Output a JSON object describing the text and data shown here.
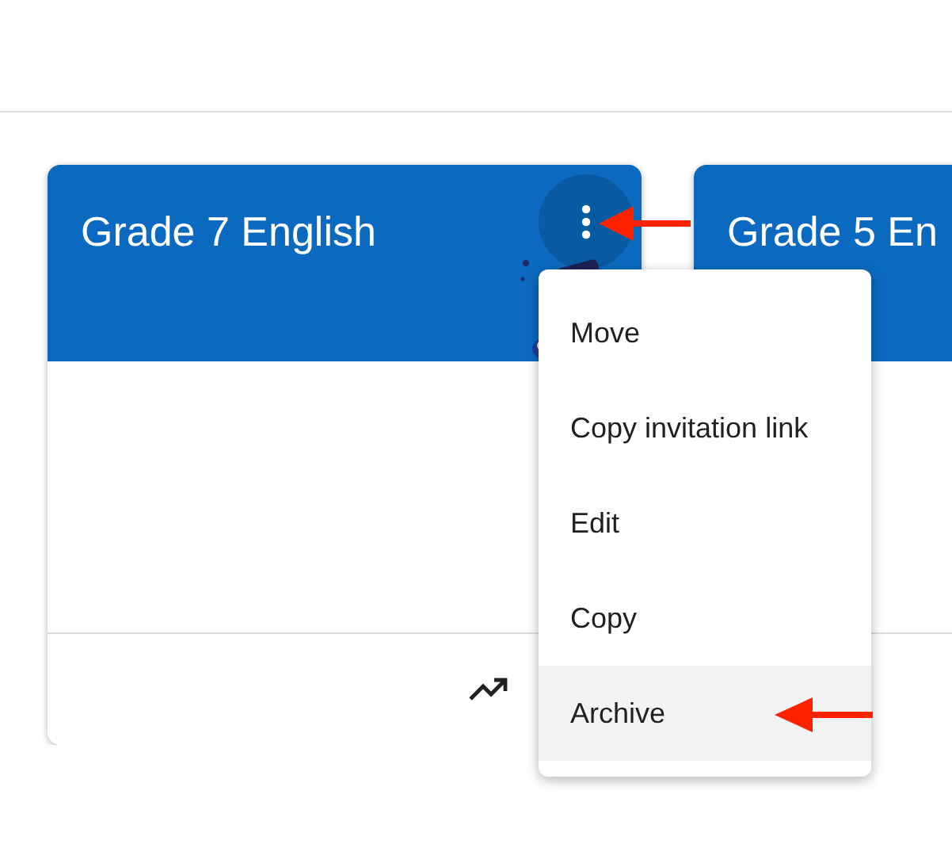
{
  "cards": [
    {
      "title": "Grade 7 English"
    },
    {
      "title": "Grade 5 En"
    }
  ],
  "menu": {
    "open": true,
    "items": [
      {
        "label": "Move",
        "selected": false
      },
      {
        "label": "Copy invitation link",
        "selected": false
      },
      {
        "label": "Edit",
        "selected": false
      },
      {
        "label": "Copy",
        "selected": false
      },
      {
        "label": "Archive",
        "selected": true
      }
    ]
  }
}
